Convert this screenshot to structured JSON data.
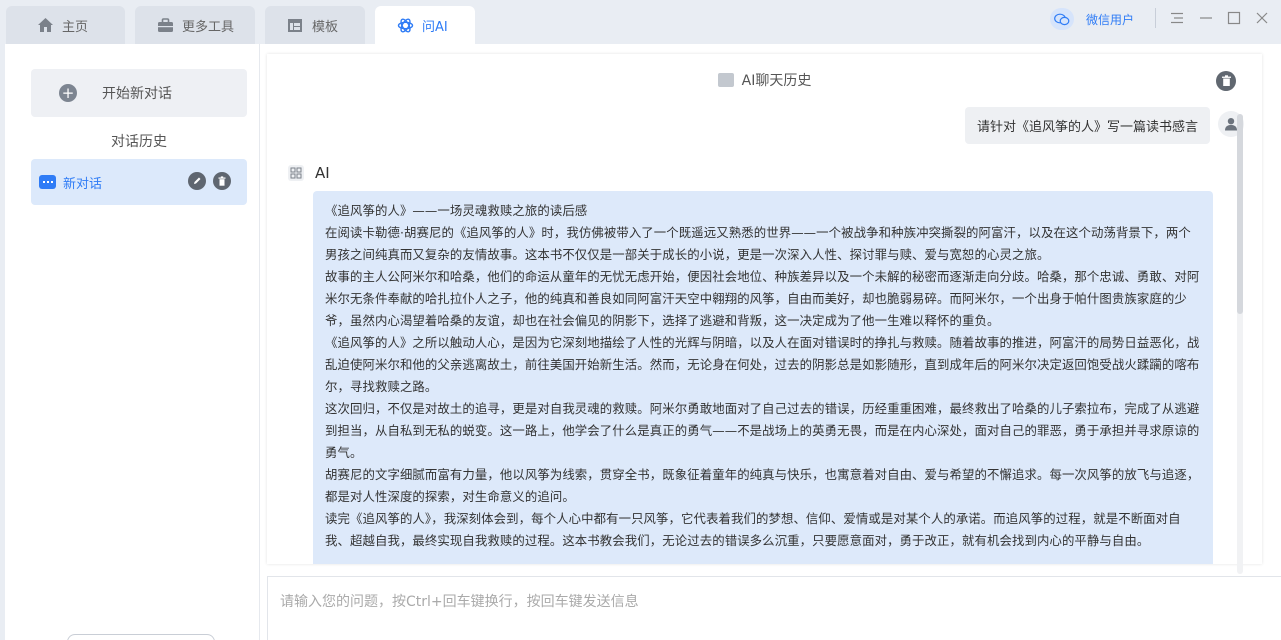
{
  "tabs": [
    {
      "label": "主页",
      "icon": "home-icon"
    },
    {
      "label": "更多工具",
      "icon": "toolbox-icon"
    },
    {
      "label": "模板",
      "icon": "template-icon"
    },
    {
      "label": "问AI",
      "icon": "ai-icon",
      "active": true
    }
  ],
  "user": {
    "name": "微信用户",
    "icon": "wechat-avatar-icon"
  },
  "window_controls": [
    "menu-icon",
    "minimize-icon",
    "maximize-icon",
    "close-icon"
  ],
  "sidebar": {
    "new_chat_label": "开始新对话",
    "history_title": "对话历史",
    "conversations": [
      {
        "label": "新对话",
        "selected": true
      }
    ]
  },
  "chat": {
    "header_title": "AI聊天历史",
    "user_message": "请针对《追风筝的人》写一篇读书感言",
    "ai_name": "AI",
    "ai_paragraphs": [
      "《追风筝的人》——一场灵魂救赎之旅的读后感",
      "在阅读卡勒德·胡赛尼的《追风筝的人》时，我仿佛被带入了一个既遥远又熟悉的世界——一个被战争和种族冲突撕裂的阿富汗，以及在这个动荡背景下，两个男孩之间纯真而又复杂的友情故事。这本书不仅仅是一部关于成长的小说，更是一次深入人性、探讨罪与赎、爱与宽恕的心灵之旅。",
      "故事的主人公阿米尔和哈桑，他们的命运从童年的无忧无虑开始，便因社会地位、种族差异以及一个未解的秘密而逐渐走向分歧。哈桑，那个忠诚、勇敢、对阿米尔无条件奉献的哈扎拉仆人之子，他的纯真和善良如同阿富汗天空中翱翔的风筝，自由而美好，却也脆弱易碎。而阿米尔，一个出身于帕什图贵族家庭的少爷，虽然内心渴望着哈桑的友谊，却也在社会偏见的阴影下，选择了逃避和背叛，这一决定成为了他一生难以释怀的重负。",
      "《追风筝的人》之所以触动人心，是因为它深刻地描绘了人性的光辉与阴暗，以及人在面对错误时的挣扎与救赎。随着故事的推进，阿富汗的局势日益恶化，战乱迫使阿米尔和他的父亲逃离故土，前往美国开始新生活。然而，无论身在何处，过去的阴影总是如影随形，直到成年后的阿米尔决定返回饱受战火蹂躏的喀布尔，寻找救赎之路。",
      "这次回归，不仅是对故土的追寻，更是对自我灵魂的救赎。阿米尔勇敢地面对了自己过去的错误，历经重重困难，最终救出了哈桑的儿子索拉布，完成了从逃避到担当，从自私到无私的蜕变。这一路上，他学会了什么是真正的勇气——不是战场上的英勇无畏，而是在内心深处，面对自己的罪恶，勇于承担并寻求原谅的勇气。",
      "胡赛尼的文字细腻而富有力量，他以风筝为线索，贯穿全书，既象征着童年的纯真与快乐，也寓意着对自由、爱与希望的不懈追求。每一次风筝的放飞与追逐，都是对人性深度的探索，对生命意义的追问。",
      "读完《追风筝的人》，我深刻体会到，每个人心中都有一只风筝，它代表着我们的梦想、信仰、爱情或是对某个人的承诺。而追风筝的过程，就是不断面对自我、超越自我，最终实现自我救赎的过程。这本书教会我们，无论过去的错误多么沉重，只要愿意面对，勇于改正，就有机会找到内心的平静与自由。"
    ]
  },
  "input": {
    "placeholder": "请输入您的问题，按Ctrl+回车键换行，按回车键发送信息",
    "value": ""
  }
}
